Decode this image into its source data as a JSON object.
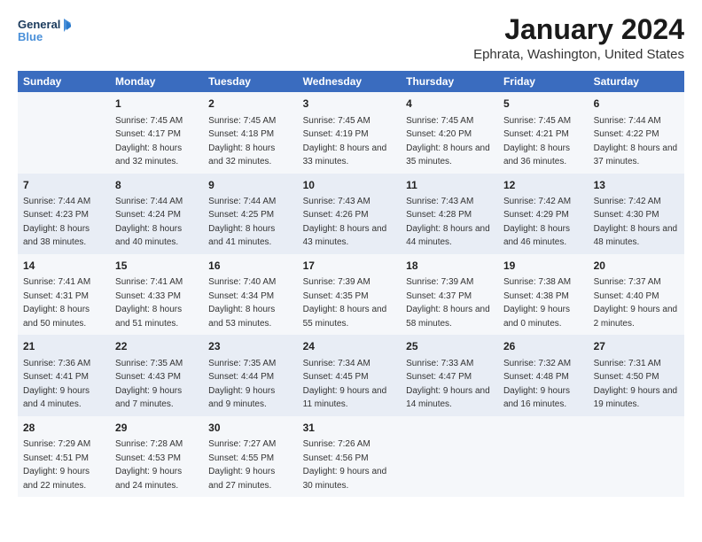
{
  "logo": {
    "line1": "General",
    "line2": "Blue"
  },
  "title": "January 2024",
  "subtitle": "Ephrata, Washington, United States",
  "headers": [
    "Sunday",
    "Monday",
    "Tuesday",
    "Wednesday",
    "Thursday",
    "Friday",
    "Saturday"
  ],
  "weeks": [
    [
      {
        "num": "",
        "sunrise": "",
        "sunset": "",
        "daylight": ""
      },
      {
        "num": "1",
        "sunrise": "Sunrise: 7:45 AM",
        "sunset": "Sunset: 4:17 PM",
        "daylight": "Daylight: 8 hours and 32 minutes."
      },
      {
        "num": "2",
        "sunrise": "Sunrise: 7:45 AM",
        "sunset": "Sunset: 4:18 PM",
        "daylight": "Daylight: 8 hours and 32 minutes."
      },
      {
        "num": "3",
        "sunrise": "Sunrise: 7:45 AM",
        "sunset": "Sunset: 4:19 PM",
        "daylight": "Daylight: 8 hours and 33 minutes."
      },
      {
        "num": "4",
        "sunrise": "Sunrise: 7:45 AM",
        "sunset": "Sunset: 4:20 PM",
        "daylight": "Daylight: 8 hours and 35 minutes."
      },
      {
        "num": "5",
        "sunrise": "Sunrise: 7:45 AM",
        "sunset": "Sunset: 4:21 PM",
        "daylight": "Daylight: 8 hours and 36 minutes."
      },
      {
        "num": "6",
        "sunrise": "Sunrise: 7:44 AM",
        "sunset": "Sunset: 4:22 PM",
        "daylight": "Daylight: 8 hours and 37 minutes."
      }
    ],
    [
      {
        "num": "7",
        "sunrise": "Sunrise: 7:44 AM",
        "sunset": "Sunset: 4:23 PM",
        "daylight": "Daylight: 8 hours and 38 minutes."
      },
      {
        "num": "8",
        "sunrise": "Sunrise: 7:44 AM",
        "sunset": "Sunset: 4:24 PM",
        "daylight": "Daylight: 8 hours and 40 minutes."
      },
      {
        "num": "9",
        "sunrise": "Sunrise: 7:44 AM",
        "sunset": "Sunset: 4:25 PM",
        "daylight": "Daylight: 8 hours and 41 minutes."
      },
      {
        "num": "10",
        "sunrise": "Sunrise: 7:43 AM",
        "sunset": "Sunset: 4:26 PM",
        "daylight": "Daylight: 8 hours and 43 minutes."
      },
      {
        "num": "11",
        "sunrise": "Sunrise: 7:43 AM",
        "sunset": "Sunset: 4:28 PM",
        "daylight": "Daylight: 8 hours and 44 minutes."
      },
      {
        "num": "12",
        "sunrise": "Sunrise: 7:42 AM",
        "sunset": "Sunset: 4:29 PM",
        "daylight": "Daylight: 8 hours and 46 minutes."
      },
      {
        "num": "13",
        "sunrise": "Sunrise: 7:42 AM",
        "sunset": "Sunset: 4:30 PM",
        "daylight": "Daylight: 8 hours and 48 minutes."
      }
    ],
    [
      {
        "num": "14",
        "sunrise": "Sunrise: 7:41 AM",
        "sunset": "Sunset: 4:31 PM",
        "daylight": "Daylight: 8 hours and 50 minutes."
      },
      {
        "num": "15",
        "sunrise": "Sunrise: 7:41 AM",
        "sunset": "Sunset: 4:33 PM",
        "daylight": "Daylight: 8 hours and 51 minutes."
      },
      {
        "num": "16",
        "sunrise": "Sunrise: 7:40 AM",
        "sunset": "Sunset: 4:34 PM",
        "daylight": "Daylight: 8 hours and 53 minutes."
      },
      {
        "num": "17",
        "sunrise": "Sunrise: 7:39 AM",
        "sunset": "Sunset: 4:35 PM",
        "daylight": "Daylight: 8 hours and 55 minutes."
      },
      {
        "num": "18",
        "sunrise": "Sunrise: 7:39 AM",
        "sunset": "Sunset: 4:37 PM",
        "daylight": "Daylight: 8 hours and 58 minutes."
      },
      {
        "num": "19",
        "sunrise": "Sunrise: 7:38 AM",
        "sunset": "Sunset: 4:38 PM",
        "daylight": "Daylight: 9 hours and 0 minutes."
      },
      {
        "num": "20",
        "sunrise": "Sunrise: 7:37 AM",
        "sunset": "Sunset: 4:40 PM",
        "daylight": "Daylight: 9 hours and 2 minutes."
      }
    ],
    [
      {
        "num": "21",
        "sunrise": "Sunrise: 7:36 AM",
        "sunset": "Sunset: 4:41 PM",
        "daylight": "Daylight: 9 hours and 4 minutes."
      },
      {
        "num": "22",
        "sunrise": "Sunrise: 7:35 AM",
        "sunset": "Sunset: 4:43 PM",
        "daylight": "Daylight: 9 hours and 7 minutes."
      },
      {
        "num": "23",
        "sunrise": "Sunrise: 7:35 AM",
        "sunset": "Sunset: 4:44 PM",
        "daylight": "Daylight: 9 hours and 9 minutes."
      },
      {
        "num": "24",
        "sunrise": "Sunrise: 7:34 AM",
        "sunset": "Sunset: 4:45 PM",
        "daylight": "Daylight: 9 hours and 11 minutes."
      },
      {
        "num": "25",
        "sunrise": "Sunrise: 7:33 AM",
        "sunset": "Sunset: 4:47 PM",
        "daylight": "Daylight: 9 hours and 14 minutes."
      },
      {
        "num": "26",
        "sunrise": "Sunrise: 7:32 AM",
        "sunset": "Sunset: 4:48 PM",
        "daylight": "Daylight: 9 hours and 16 minutes."
      },
      {
        "num": "27",
        "sunrise": "Sunrise: 7:31 AM",
        "sunset": "Sunset: 4:50 PM",
        "daylight": "Daylight: 9 hours and 19 minutes."
      }
    ],
    [
      {
        "num": "28",
        "sunrise": "Sunrise: 7:29 AM",
        "sunset": "Sunset: 4:51 PM",
        "daylight": "Daylight: 9 hours and 22 minutes."
      },
      {
        "num": "29",
        "sunrise": "Sunrise: 7:28 AM",
        "sunset": "Sunset: 4:53 PM",
        "daylight": "Daylight: 9 hours and 24 minutes."
      },
      {
        "num": "30",
        "sunrise": "Sunrise: 7:27 AM",
        "sunset": "Sunset: 4:55 PM",
        "daylight": "Daylight: 9 hours and 27 minutes."
      },
      {
        "num": "31",
        "sunrise": "Sunrise: 7:26 AM",
        "sunset": "Sunset: 4:56 PM",
        "daylight": "Daylight: 9 hours and 30 minutes."
      },
      {
        "num": "",
        "sunrise": "",
        "sunset": "",
        "daylight": ""
      },
      {
        "num": "",
        "sunrise": "",
        "sunset": "",
        "daylight": ""
      },
      {
        "num": "",
        "sunrise": "",
        "sunset": "",
        "daylight": ""
      }
    ]
  ]
}
